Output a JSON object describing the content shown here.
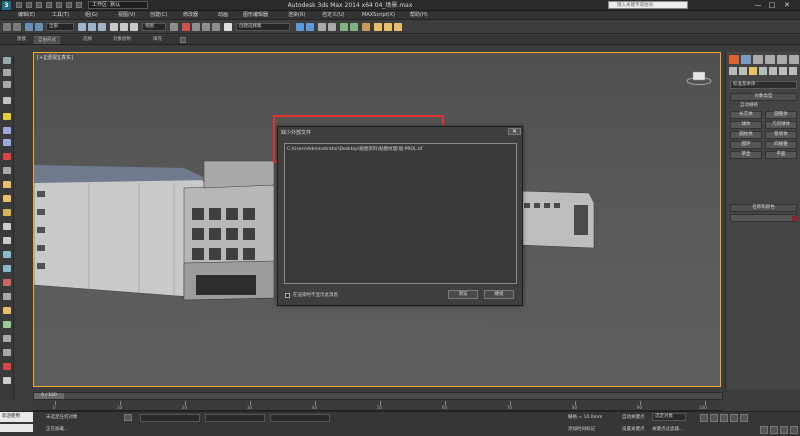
{
  "title_bar": {
    "logo": "3",
    "workspace": "工作区: 默认",
    "app_title": "Autodesk 3ds Max 2014 x64    04_场景.max",
    "search_placeholder": "键入关键字或短语",
    "window_buttons": [
      "—",
      "□",
      "✕"
    ]
  },
  "menu": {
    "items": [
      "编辑(E)",
      "工具(T)",
      "组(G)",
      "视图(V)",
      "创建(C)",
      "修改器",
      "动画",
      "图形编辑器",
      "渲染(R)",
      "自定义(U)",
      "MAXScript(X)",
      "帮助(H)"
    ]
  },
  "toolbar": {
    "selection_filter": "全部",
    "view_dropdown": "视图",
    "named_selection": "创建选择集"
  },
  "ribbon": {
    "tabs": [
      "建模",
      "自由形式",
      "选择",
      "对象绘制",
      "填充"
    ],
    "active_index": 1
  },
  "viewport": {
    "label": "[+][透视][真实]"
  },
  "dialog": {
    "title": "缺少外部文件",
    "close": "✕",
    "missing_path": "C:\\Users\\Administrator\\Desktop\\贴图资料\\贴图纹理\\墙-PROL.tif",
    "checkbox_label": "在渲染时不显示此消息",
    "browse_button": "浏览",
    "continue_button": "继续"
  },
  "command_panel": {
    "category_dropdown": "标准基本体",
    "object_type_header": "对象类型",
    "autogrid_label": "自动栅格",
    "buttons": [
      "长方体",
      "圆锥体",
      "球体",
      "几何球体",
      "圆柱体",
      "管状体",
      "圆环",
      "四棱锥",
      "茶壶",
      "平面"
    ],
    "name_color_header": "名称和颜色",
    "colors": {
      "object_color": "#9c1b2c"
    }
  },
  "timeline": {
    "slider_label": "0 / 100",
    "ticks": [
      "0",
      "10",
      "20",
      "30",
      "40",
      "50",
      "60",
      "70",
      "80",
      "90",
      "100"
    ]
  },
  "status_bar": {
    "welcome": "欢迎使用 MaxSc",
    "maxscript": "",
    "selection_status": "未选定任何对象",
    "prompt": "正在加载...",
    "add_time_tag": "添加时间标记",
    "grid_label": "栅格 = 10.0mm",
    "auto_key": "自动关键点",
    "set_key": "设置关键点",
    "key_filter": "选定对象",
    "key_filters_btn": "关键点过滤器..."
  }
}
